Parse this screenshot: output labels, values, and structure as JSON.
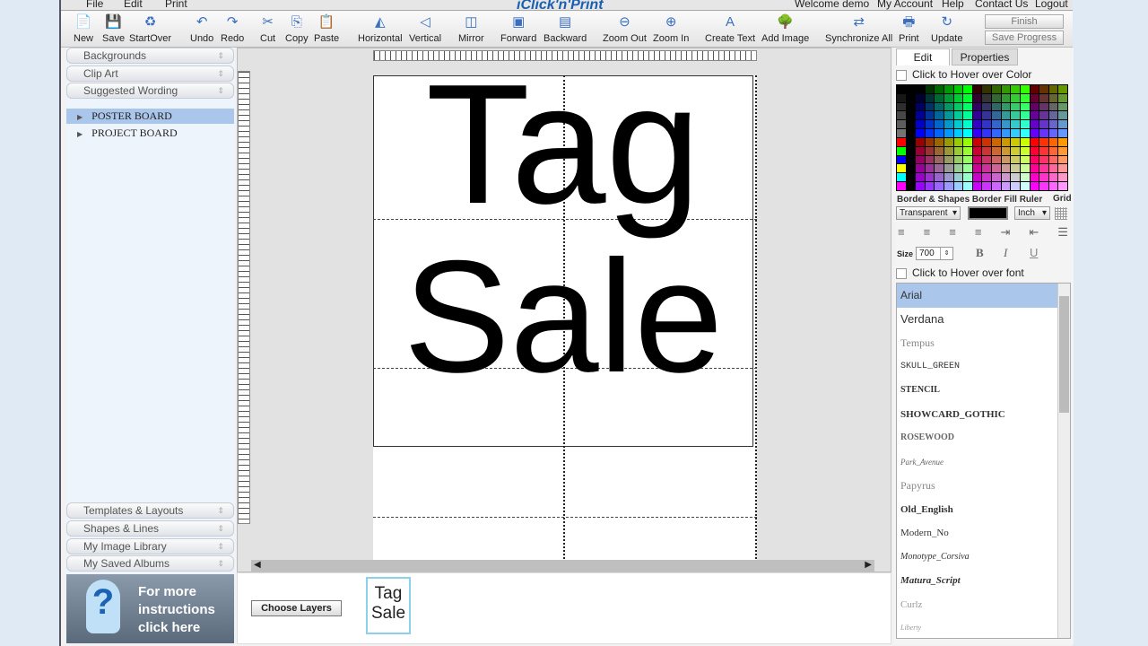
{
  "menu": {
    "file": "File",
    "edit": "Edit",
    "print": "Print",
    "logo": "iClick'n'Print",
    "welcome": "Welcome demo",
    "account": "My Account",
    "help": "Help",
    "contact": "Contact Us",
    "logout": "Logout"
  },
  "toolbar": [
    {
      "label": "New",
      "icon": "📄"
    },
    {
      "label": "Save",
      "icon": "💾"
    },
    {
      "label": "StartOver",
      "icon": "♻"
    },
    {
      "label": "Undo",
      "icon": "↶"
    },
    {
      "label": "Redo",
      "icon": "↷"
    },
    {
      "label": "Cut",
      "icon": "✂"
    },
    {
      "label": "Copy",
      "icon": "⎘"
    },
    {
      "label": "Paste",
      "icon": "📋"
    },
    {
      "label": "Horizontal",
      "icon": "◭"
    },
    {
      "label": "Vertical",
      "icon": "◁"
    },
    {
      "label": "Mirror",
      "icon": "◫"
    },
    {
      "label": "Forward",
      "icon": "▣"
    },
    {
      "label": "Backward",
      "icon": "▤"
    },
    {
      "label": "Zoom Out",
      "icon": "⊖"
    },
    {
      "label": "Zoom In",
      "icon": "⊕"
    },
    {
      "label": "Create Text",
      "icon": "A"
    },
    {
      "label": "Add Image",
      "icon": "🌳"
    },
    {
      "label": "Synchronize All",
      "icon": "⇄"
    },
    {
      "label": "Print",
      "icon": "🖶"
    },
    {
      "label": "Update",
      "icon": "↻"
    }
  ],
  "finish": "Finish",
  "save_progress": "Save Progress",
  "left": {
    "top_sections": [
      "Backgrounds",
      "Clip Art",
      "Suggested Wording"
    ],
    "tree": [
      "POSTER BOARD",
      "PROJECT BOARD"
    ],
    "bottom_sections": [
      "Templates & Layouts",
      "Shapes & Lines",
      "My Image Library",
      "My Saved Albums"
    ],
    "help": [
      "For more",
      "instructions",
      "click here"
    ]
  },
  "canvas": {
    "line1": "Tag",
    "line2": "Sale"
  },
  "bottom": {
    "choose_layers": "Choose Layers",
    "thumb1": "Tag",
    "thumb2": "Sale"
  },
  "right": {
    "tab_edit": "Edit",
    "tab_properties": "Properties",
    "hover_color": "Click to Hover over Color",
    "border_label": "Border & Shapes Border Fill Ruler",
    "grid_label": "Grid",
    "border_value": "Transparent",
    "ruler_value": "Inch",
    "size_label": "Size",
    "size_value": "700",
    "bold": "B",
    "italic": "I",
    "underline": "U",
    "hover_font": "Click to Hover over font",
    "fonts": [
      "Arial",
      "Verdana",
      "Tempus",
      "SKULL_GREEN",
      "STENCIL",
      "SHOWCARD_GOTHIC",
      "ROSEWOOD",
      "Park_Avenue",
      "Papyrus",
      "Old_English",
      "Modern_No",
      "Monotype_Corsiva",
      "Matura_Script",
      "Curlz",
      "Liberty"
    ],
    "selected_font": "Arial"
  }
}
